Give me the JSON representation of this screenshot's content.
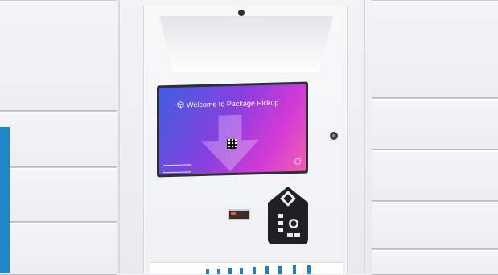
{
  "screen": {
    "header_text": "",
    "welcome_text": "Welcome to Package Pickup",
    "scan_text": "",
    "button_text": ""
  },
  "colors": {
    "accent": "#1f86c8",
    "screen_gradient_start": "#3f5fe0",
    "screen_gradient_end": "#f25fb0",
    "keypad": "#1e2024"
  },
  "icons": [
    "camera-icon",
    "package-icon",
    "down-arrow-icon",
    "qr-code-icon",
    "lock-icon",
    "card-reader-icon",
    "keypad-icon"
  ]
}
